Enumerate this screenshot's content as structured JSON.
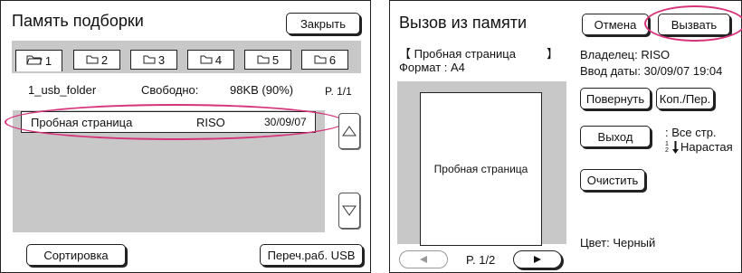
{
  "left": {
    "title": "Память подборки",
    "close_label": "Закрыть",
    "tabs": [
      "1",
      "2",
      "3",
      "4",
      "5",
      "6"
    ],
    "folder_name": "1_usb_folder",
    "free_label": "Свободно:",
    "free_value": "98KB (90%)",
    "page": "P. 1/1",
    "file": {
      "name": "Пробная страница",
      "owner": "RISO",
      "date": "30/09/07"
    },
    "sort_label": "Сортировка",
    "usb_label": "Переч.раб. USB"
  },
  "right": {
    "title": "Вызов из памяти",
    "cancel_label": "Отмена",
    "recall_label": "Вызвать",
    "doc_name_open": "【 Пробная страница",
    "doc_name_close": "】",
    "format": "Формат : A4",
    "owner": "Владелец: RISO",
    "date_entry": "Ввод даты: 30/09/07 19:04",
    "rotate_label": "Повернуть",
    "copies_label": "Коп./Пер.",
    "output_label": "Выход",
    "all_pages": ": Все стр.",
    "order_icon_text": "1 2",
    "ascending": "Нарастая",
    "clear_label": "Очистить",
    "preview_label": "Пробная страница",
    "color": "Цвет: Черный",
    "page": "P. 1/2"
  },
  "colors": {
    "highlight": "#d6337a",
    "panel_gray": "#c8c8c8"
  }
}
